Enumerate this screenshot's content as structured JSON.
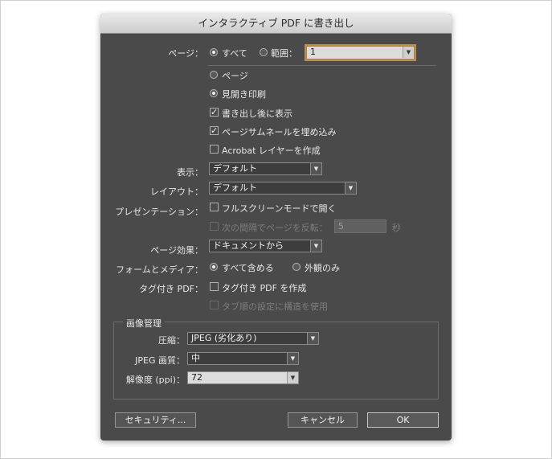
{
  "dialog": {
    "title": "インタラクティブ PDF に書き出し",
    "pages": {
      "label": "ページ：",
      "all_label": "すべて",
      "range_label": "範囲：",
      "range_value": "1",
      "selected": "all"
    },
    "spread_mode": {
      "pages_label": "ページ",
      "spreads_label": "見開き印刷",
      "selected": "spreads"
    },
    "options": {
      "view_after_export": {
        "label": "書き出し後に表示",
        "checked": true
      },
      "embed_thumbnails": {
        "label": "ページサムネールを埋め込み",
        "checked": true
      },
      "acrobat_layers": {
        "label": "Acrobat レイヤーを作成",
        "checked": false
      }
    },
    "display": {
      "label": "表示：",
      "value": "デフォルト"
    },
    "layout": {
      "label": "レイアウト：",
      "value": "デフォルト"
    },
    "presentation": {
      "label": "プレゼンテーション：",
      "fullscreen_label": "フルスクリーンモードで開く",
      "fullscreen_checked": false,
      "flip_label": "次の間隔でページを反転：",
      "flip_checked": false,
      "flip_value": "5",
      "flip_unit": "秒"
    },
    "page_transitions": {
      "label": "ページ効果：",
      "value": "ドキュメントから"
    },
    "forms_media": {
      "label": "フォームとメディア：",
      "include_all_label": "すべて含める",
      "appearance_only_label": "外観のみ",
      "selected": "include_all"
    },
    "tagged_pdf": {
      "label": "タグ付き PDF：",
      "create_label": "タグ付き PDF を作成",
      "create_checked": false,
      "tab_order_label": "タブ順の設定に構造を使用",
      "tab_order_checked": false
    },
    "image_management": {
      "legend": "画像管理",
      "compression_label": "圧縮：",
      "compression_value": "JPEG (劣化あり)",
      "quality_label": "JPEG 画質：",
      "quality_value": "中",
      "resolution_label": "解像度 (ppi)：",
      "resolution_value": "72"
    },
    "buttons": {
      "security": "セキュリティ...",
      "cancel": "キャンセル",
      "ok": "OK"
    }
  }
}
